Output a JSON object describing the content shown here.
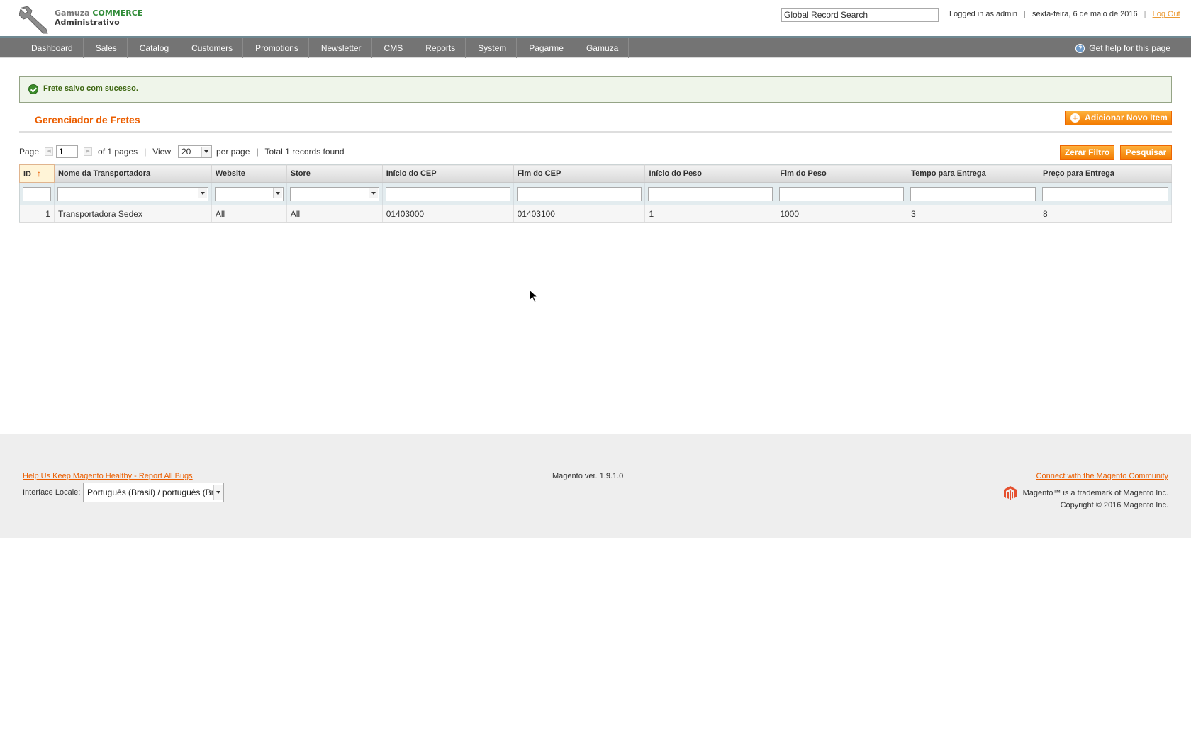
{
  "header": {
    "logo_brand": "Gamuza",
    "logo_commerce": "COMMERCE",
    "logo_admin": "Administrativo",
    "search_value": "Global Record Search",
    "logged_in": "Logged in as admin",
    "date": "sexta-feira, 6 de maio de 2016",
    "logout": "Log Out"
  },
  "nav": {
    "items": [
      "Dashboard",
      "Sales",
      "Catalog",
      "Customers",
      "Promotions",
      "Newsletter",
      "CMS",
      "Reports",
      "System",
      "Pagarme",
      "Gamuza"
    ],
    "help": "Get help for this page"
  },
  "message": {
    "success": "Frete salvo com sucesso."
  },
  "page": {
    "title": "Gerenciador de Fretes",
    "add_button": "Adicionar Novo Item"
  },
  "pager": {
    "page_label": "Page",
    "page_value": "1",
    "of_pages": "of 1 pages",
    "view_label": "View",
    "per_page_value": "20",
    "per_page_label": "per page",
    "total": "Total 1 records found",
    "reset_button": "Zerar Filtro",
    "search_button": "Pesquisar"
  },
  "grid": {
    "headers": [
      "ID",
      "Nome da Transportadora",
      "Website",
      "Store",
      "Início do CEP",
      "Fim do CEP",
      "Início do Peso",
      "Fim do Peso",
      "Tempo para Entrega",
      "Preço para Entrega"
    ],
    "rows": [
      [
        "1",
        "Transportadora Sedex",
        "All",
        "All",
        "01403000",
        "01403100",
        "1",
        "1000",
        "3",
        "8"
      ]
    ]
  },
  "footer": {
    "bugs_link": "Help Us Keep Magento Healthy - Report All Bugs",
    "locale_label": "Interface Locale:",
    "locale_value": "Português (Brasil) / português (Brasil)",
    "version": "Magento ver. 1.9.1.0",
    "community_link": "Connect with the Magento Community",
    "trademark": "Magento™ is a trademark of Magento Inc.",
    "copyright": "Copyright © 2016 Magento Inc."
  },
  "colors": {
    "accent": "#eb5e00",
    "nav_bg": "#747474",
    "success_bg": "#eff5ea",
    "button": "#f37b00"
  }
}
